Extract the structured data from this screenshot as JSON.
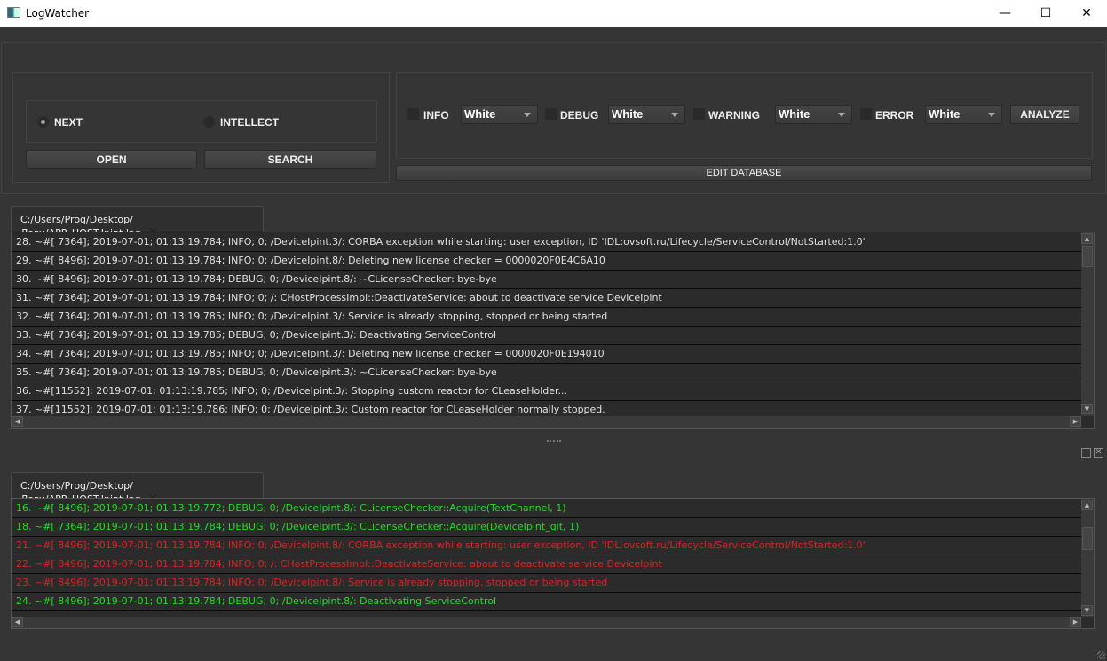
{
  "window": {
    "title": "LogWatcher",
    "minimize": "—",
    "maximize": "☐",
    "close": "✕"
  },
  "source": {
    "options": [
      {
        "label": "NEXT",
        "selected": true
      },
      {
        "label": "INTELLECT",
        "selected": false
      }
    ],
    "open_label": "OPEN",
    "search_label": "SEARCH"
  },
  "filters": [
    {
      "label": "INFO",
      "checked": false,
      "color": "White"
    },
    {
      "label": "DEBUG",
      "checked": false,
      "color": "White"
    },
    {
      "label": "WARNING",
      "checked": false,
      "color": "White"
    },
    {
      "label": "ERROR",
      "checked": false,
      "color": "White"
    }
  ],
  "analyze_label": "ANALYZE",
  "edit_database_label": "EDIT DATABASE",
  "colors": {
    "green": "#22dd22",
    "red": "#dd2222",
    "text": "#e0e0e0"
  },
  "pane1": {
    "tab": "C:/Users/Prog/Desktop/Логи/APP_HOST.Ipint.log",
    "rows": [
      {
        "text": "28. ~#[ 7364]; 2019-07-01; 01:13:19.784; INFO; 0; /DeviceIpint.3/: CORBA exception while starting: user exception, ID 'IDL:ovsoft.ru/Lifecycle/ServiceControl/NotStarted:1.0'",
        "color": "#e0e0e0"
      },
      {
        "text": "29. ~#[ 8496]; 2019-07-01; 01:13:19.784; INFO; 0; /DeviceIpint.8/: Deleting new license checker = 0000020F0E4C6A10",
        "color": "#e0e0e0"
      },
      {
        "text": "30. ~#[ 8496]; 2019-07-01; 01:13:19.784; DEBUG; 0; /DeviceIpint.8/: ~CLicenseChecker: bye-bye",
        "color": "#e0e0e0"
      },
      {
        "text": "31. ~#[ 7364]; 2019-07-01; 01:13:19.784; INFO; 0; /: CHostProcessImpl::DeactivateService: about to deactivate service DeviceIpint",
        "color": "#e0e0e0"
      },
      {
        "text": "32. ~#[ 7364]; 2019-07-01; 01:13:19.785; INFO; 0; /DeviceIpint.3/: Service is already stopping, stopped or being started",
        "color": "#e0e0e0"
      },
      {
        "text": "33. ~#[ 7364]; 2019-07-01; 01:13:19.785; DEBUG; 0; /DeviceIpint.3/: Deactivating ServiceControl",
        "color": "#e0e0e0"
      },
      {
        "text": "34. ~#[ 7364]; 2019-07-01; 01:13:19.785; INFO; 0; /DeviceIpint.3/: Deleting new license checker = 0000020F0E194010",
        "color": "#e0e0e0"
      },
      {
        "text": "35. ~#[ 7364]; 2019-07-01; 01:13:19.785; DEBUG; 0; /DeviceIpint.3/: ~CLicenseChecker: bye-bye",
        "color": "#e0e0e0"
      },
      {
        "text": "36. ~#[11552]; 2019-07-01; 01:13:19.785; INFO; 0; /DeviceIpint.3/: Stopping custom reactor for CLeaseHolder...",
        "color": "#e0e0e0"
      },
      {
        "text": "37. ~#[11552]; 2019-07-01; 01:13:19.786; INFO; 0; /DeviceIpint.3/: Custom reactor for CLeaseHolder normally stopped.",
        "color": "#e0e0e0"
      }
    ]
  },
  "pane2": {
    "tab": "C:/Users/Prog/Desktop/Логи/APP_HOST.Ipint.log",
    "rows": [
      {
        "text": "16. ~#[ 8496]; 2019-07-01; 01:13:19.772; DEBUG; 0; /DeviceIpint.8/: CLicenseChecker::Acquire(TextChannel, 1)",
        "color": "#22dd22"
      },
      {
        "text": "18. ~#[ 7364]; 2019-07-01; 01:13:19.784; DEBUG; 0; /DeviceIpint.3/: CLicenseChecker::Acquire(DeviceIpint_git, 1)",
        "color": "#22dd22"
      },
      {
        "text": "21. ~#[ 8496]; 2019-07-01; 01:13:19.784; INFO; 0; /DeviceIpint.8/: CORBA exception while starting: user exception, ID 'IDL:ovsoft.ru/Lifecycle/ServiceControl/NotStarted:1.0'",
        "color": "#dd2222"
      },
      {
        "text": "22. ~#[ 8496]; 2019-07-01; 01:13:19.784; INFO; 0; /: CHostProcessImpl::DeactivateService: about to deactivate service DeviceIpint",
        "color": "#dd2222"
      },
      {
        "text": "23. ~#[ 8496]; 2019-07-01; 01:13:19.784; INFO; 0; /DeviceIpint.8/: Service is already stopping, stopped or being started",
        "color": "#dd2222"
      },
      {
        "text": "24. ~#[ 8496]; 2019-07-01; 01:13:19.784; DEBUG; 0; /DeviceIpint.8/: Deactivating ServiceControl",
        "color": "#22dd22"
      }
    ]
  }
}
